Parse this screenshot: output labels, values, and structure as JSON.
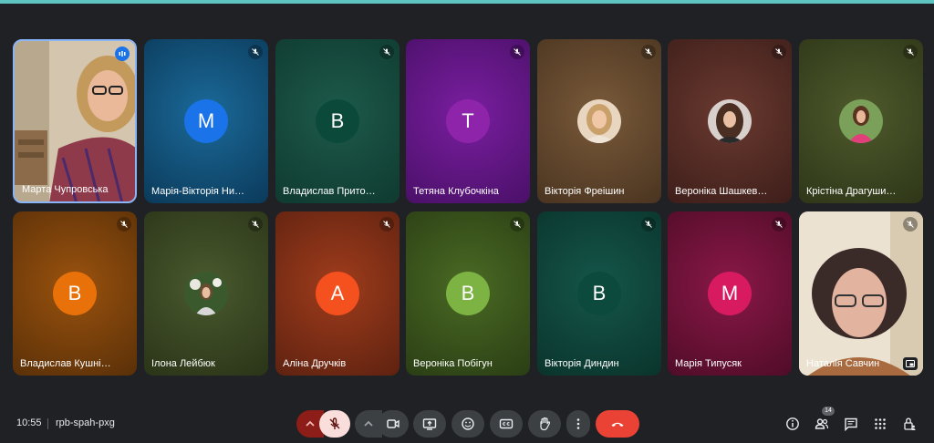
{
  "participants": [
    {
      "name": "Марта Чупровська",
      "type": "video",
      "speaking": true
    },
    {
      "name": "Марія-Вікторія Нико…",
      "type": "letter",
      "initial": "М",
      "avatar_color": "#1a73e8",
      "tile_color": "#0e4a6e"
    },
    {
      "name": "Владислав Притоць…",
      "type": "letter",
      "initial": "В",
      "avatar_color": "#0b5544",
      "tile_color": "#124a3c"
    },
    {
      "name": "Тетяна Клубочкіна",
      "type": "letter",
      "initial": "Т",
      "avatar_color": "#7b1fa2",
      "tile_color": "#5c1478"
    },
    {
      "name": "Вікторія Фреішин",
      "type": "photo",
      "tile_color": "#6b4a2a"
    },
    {
      "name": "Вероніка Шашкевич",
      "type": "photo",
      "tile_color": "#5a2a24"
    },
    {
      "name": "Крістіна Драгушин…",
      "type": "photo",
      "tile_color": "#3f4a22"
    },
    {
      "name": "Владислав Кушнірюк",
      "type": "letter",
      "initial": "В",
      "avatar_color": "#e8710a",
      "tile_color": "#8a4a0e"
    },
    {
      "name": "Ілона Лейбюк",
      "type": "photo",
      "tile_color": "#3e4a28"
    },
    {
      "name": "Аліна Дручків",
      "type": "letter",
      "initial": "А",
      "avatar_color": "#f4511e",
      "tile_color": "#8e3418"
    },
    {
      "name": "Вероніка Побігун",
      "type": "letter",
      "initial": "В",
      "avatar_color": "#7cb342",
      "tile_color": "#3f5a20"
    },
    {
      "name": "Вікторія Диндин",
      "type": "letter",
      "initial": "В",
      "avatar_color": "#0b4f3e",
      "tile_color": "#0f4a3e"
    },
    {
      "name": "Марія Типусяк",
      "type": "letter",
      "initial": "М",
      "avatar_color": "#d81b60",
      "tile_color": "#7a1540"
    },
    {
      "name": "Наталія Савчин",
      "type": "video"
    }
  ],
  "bottom_bar": {
    "time": "10:55",
    "meeting_code": "rpb-spah-pxg",
    "participants_count": "14"
  },
  "colors": {
    "background": "#202124",
    "top_accent": "#5fc4c0",
    "mic_off_active": "#f9dedc",
    "end_call": "#ea4335",
    "button": "#3c4043"
  }
}
